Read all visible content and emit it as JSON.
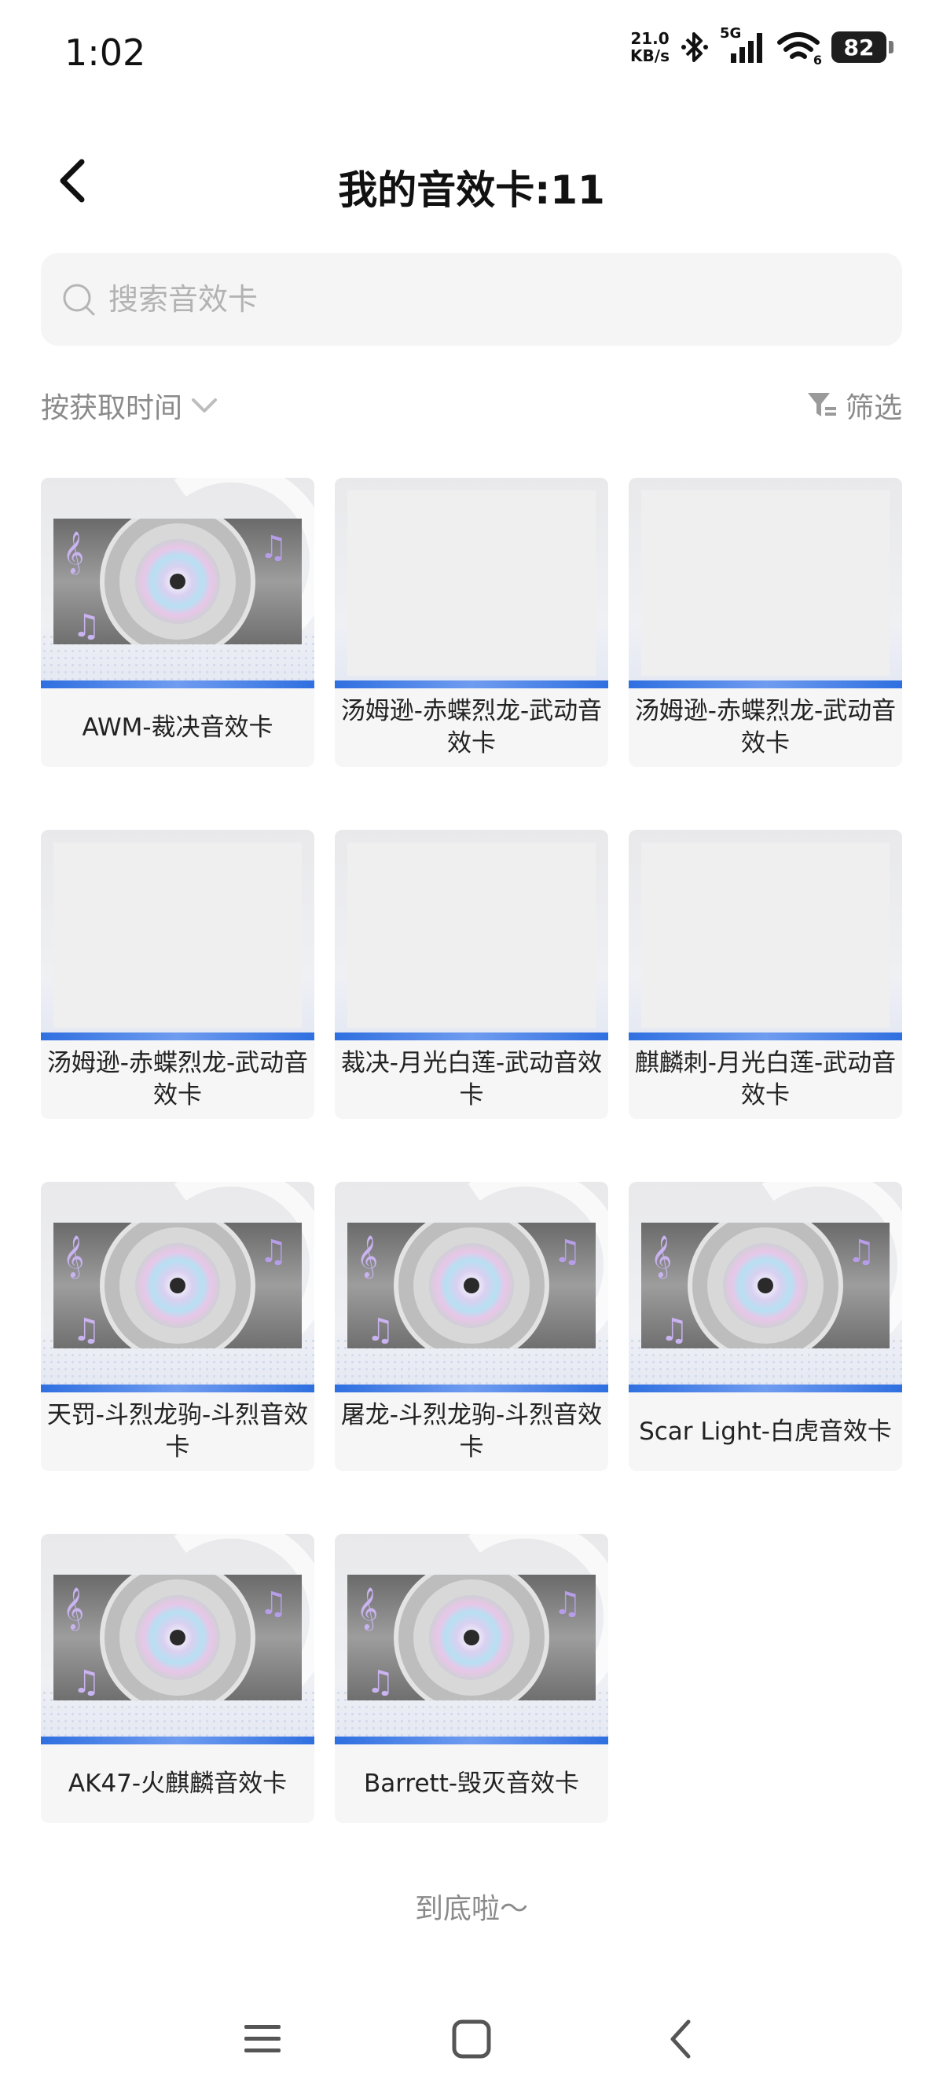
{
  "status_bar": {
    "time": "1:02",
    "net_speed_value": "21.0",
    "net_speed_unit": "KB/s",
    "signal_label": "5G",
    "wifi_badge": "6",
    "battery": "82"
  },
  "header": {
    "title": "我的音效卡:11"
  },
  "search": {
    "placeholder": "搜索音效卡",
    "value": ""
  },
  "toolbar": {
    "sort_label": "按获取时间",
    "filter_label": "筛选"
  },
  "cards": [
    {
      "label": "AWM-裁决音效卡",
      "has_art": true
    },
    {
      "label": "汤姆逊-赤蝶烈龙-武动音效卡",
      "has_art": false
    },
    {
      "label": "汤姆逊-赤蝶烈龙-武动音效卡",
      "has_art": false
    },
    {
      "label": "汤姆逊-赤蝶烈龙-武动音效卡",
      "has_art": false
    },
    {
      "label": "裁决-月光白莲-武动音效卡",
      "has_art": false
    },
    {
      "label": "麒麟刺-月光白莲-武动音效卡",
      "has_art": false
    },
    {
      "label": "天罚-斗烈龙驹-斗烈音效卡",
      "has_art": true
    },
    {
      "label": "屠龙-斗烈龙驹-斗烈音效卡",
      "has_art": true
    },
    {
      "label": "Scar Light-白虎音效卡",
      "has_art": true
    },
    {
      "label": "AK47-火麒麟音效卡",
      "has_art": true
    },
    {
      "label": "Barrett-毁灭音效卡",
      "has_art": true
    }
  ],
  "footer": {
    "end_text": "到底啦～"
  },
  "icons": {
    "back": "chevron-left-icon",
    "search": "search-icon",
    "sort": "chevron-down-icon",
    "filter": "filter-icon",
    "nav_menu": "menu-icon",
    "nav_home": "home-square-icon",
    "nav_back": "back-chevron-icon"
  },
  "colors": {
    "accent_blue": "#2f6fe0",
    "muted_text": "#8a8a8a",
    "card_bg": "#f6f6f6",
    "search_bg": "#f5f5f5"
  }
}
